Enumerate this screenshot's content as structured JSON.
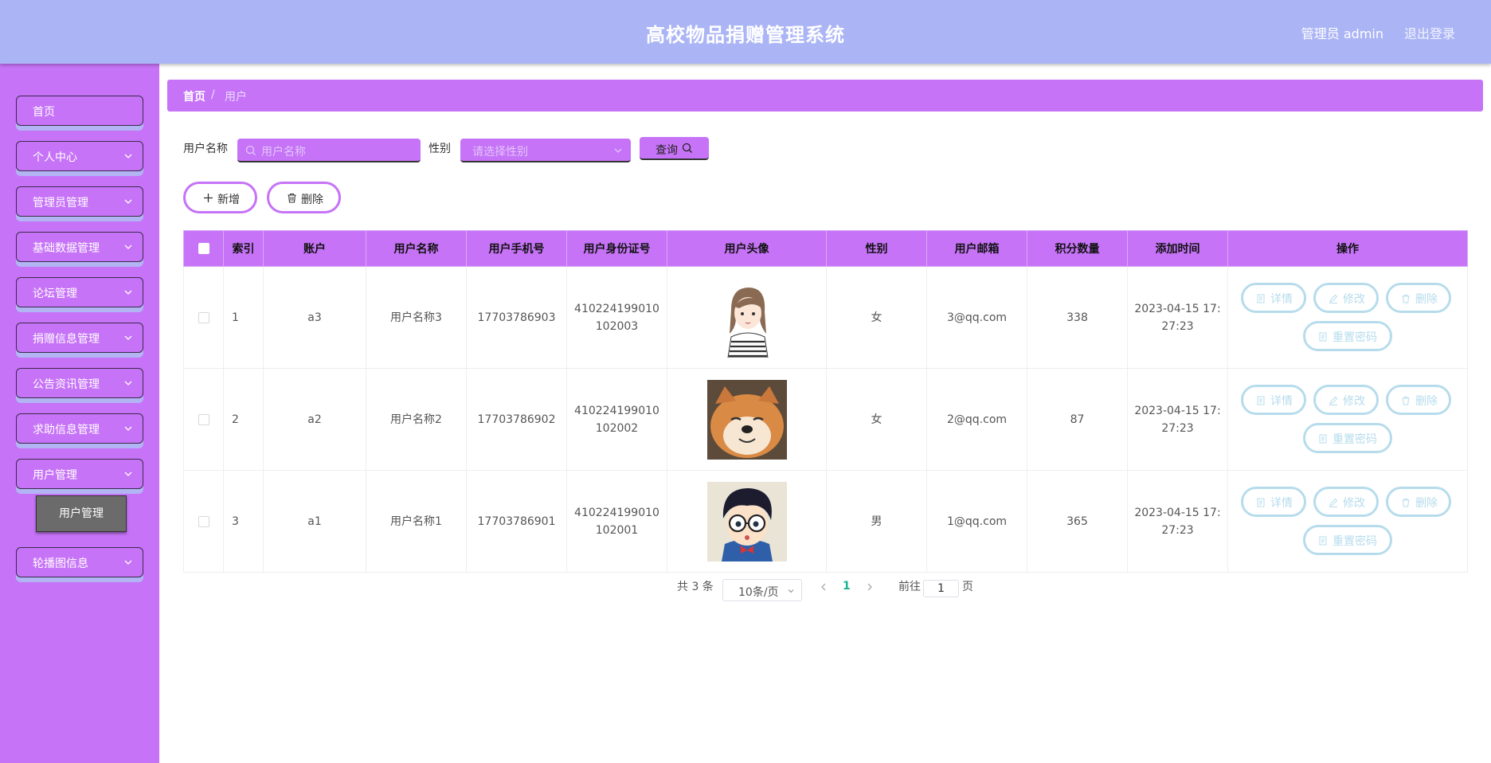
{
  "header": {
    "title": "高校物品捐赠管理系统",
    "user": "管理员 admin",
    "logout": "退出登录"
  },
  "sidebar": {
    "items": [
      {
        "label": "首页",
        "has_arrow": false
      },
      {
        "label": "个人中心",
        "has_arrow": true
      },
      {
        "label": "管理员管理",
        "has_arrow": true
      },
      {
        "label": "基础数据管理",
        "has_arrow": true
      },
      {
        "label": "论坛管理",
        "has_arrow": true
      },
      {
        "label": "捐赠信息管理",
        "has_arrow": true
      },
      {
        "label": "公告资讯管理",
        "has_arrow": true
      },
      {
        "label": "求助信息管理",
        "has_arrow": true
      },
      {
        "label": "用户管理",
        "has_arrow": true
      },
      {
        "label": "轮播图信息",
        "has_arrow": true
      }
    ],
    "submenu_active": "用户管理"
  },
  "breadcrumb": {
    "home": "首页",
    "separator": "/",
    "current": "用户"
  },
  "search": {
    "username_label": "用户名称",
    "username_placeholder": "用户名称",
    "gender_label": "性别",
    "gender_placeholder": "请选择性别",
    "query_label": "查询"
  },
  "actions": {
    "add_label": "新增",
    "delete_label": "删除"
  },
  "table": {
    "columns": [
      "索引",
      "账户",
      "用户名称",
      "用户手机号",
      "用户身份证号",
      "用户头像",
      "性别",
      "用户邮箱",
      "积分数量",
      "添加时间",
      "操作"
    ],
    "rows": [
      {
        "index": "1",
        "account": "a3",
        "name": "用户名称3",
        "phone": "17703786903",
        "id_line1": "410224199010",
        "id_line2": "102003",
        "avatar": "girl-avatar",
        "gender": "女",
        "email": "3@qq.com",
        "points": "338",
        "time_line1": "2023-04-15 17:",
        "time_line2": "27:23"
      },
      {
        "index": "2",
        "account": "a2",
        "name": "用户名称2",
        "phone": "17703786902",
        "id_line1": "410224199010",
        "id_line2": "102002",
        "avatar": "shiba-avatar",
        "gender": "女",
        "email": "2@qq.com",
        "points": "87",
        "time_line1": "2023-04-15 17:",
        "time_line2": "27:23"
      },
      {
        "index": "3",
        "account": "a1",
        "name": "用户名称1",
        "phone": "17703786901",
        "id_line1": "410224199010",
        "id_line2": "102001",
        "avatar": "cartoon-boy-avatar",
        "gender": "男",
        "email": "1@qq.com",
        "points": "365",
        "time_line1": "2023-04-15 17:",
        "time_line2": "27:23"
      }
    ],
    "ops": {
      "detail": "详情",
      "edit": "修改",
      "delete": "删除",
      "reset": "重置密码"
    }
  },
  "pagination": {
    "total": "共 3 条",
    "page_size": "10条/页",
    "current": "1",
    "goto_label": "前往",
    "goto_value": "1",
    "page_suffix": "页"
  },
  "colors": {
    "header": "#abb5f6",
    "sidebar": "#c673f7",
    "op_button": "#b6dcec",
    "active_page": "#1ab394"
  }
}
